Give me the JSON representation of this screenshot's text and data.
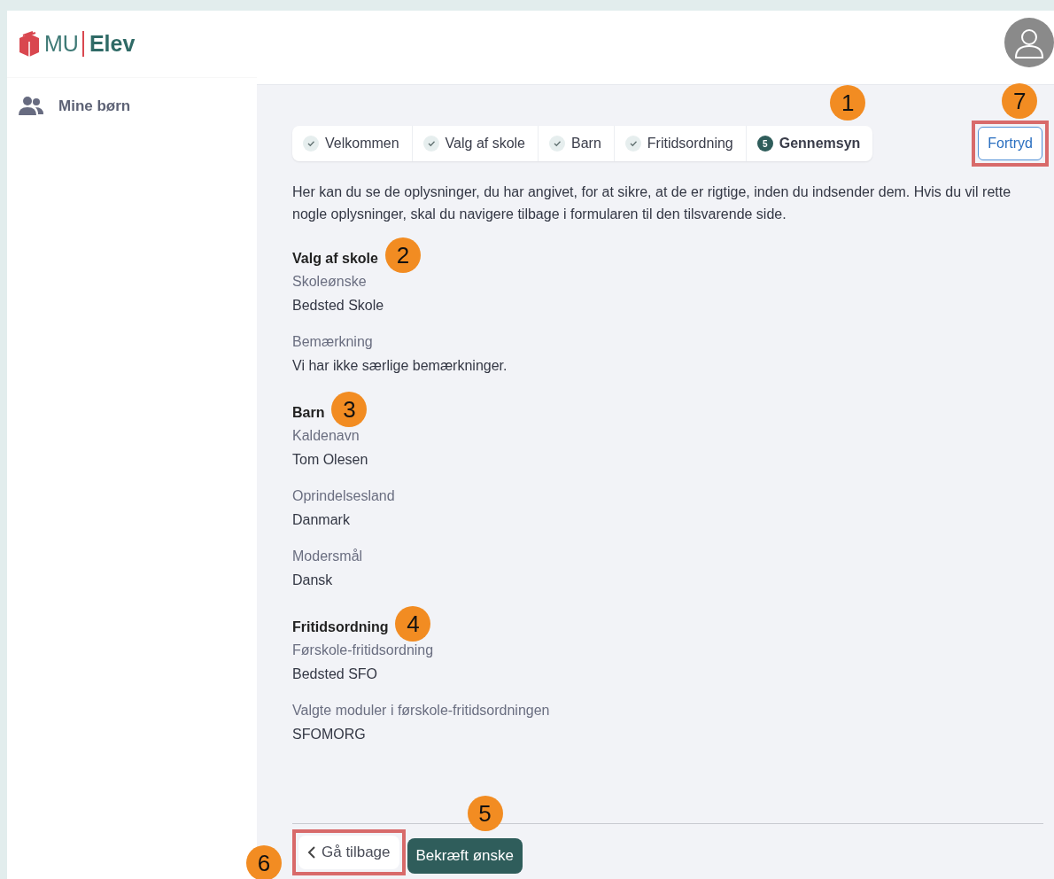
{
  "sidebar": {
    "logo": {
      "mark": "MU",
      "name": "Elev"
    },
    "items": [
      {
        "label": "Mine børn"
      }
    ]
  },
  "stepper": {
    "callout": "1",
    "steps": [
      {
        "kind": "done",
        "label": "Velkommen"
      },
      {
        "kind": "done",
        "label": "Valg af skole"
      },
      {
        "kind": "done",
        "label": "Barn"
      },
      {
        "kind": "done",
        "label": "Fritidsordning"
      },
      {
        "kind": "current",
        "number": "5",
        "label": "Gennemsyn"
      }
    ]
  },
  "cancel_button": {
    "label": "Fortryd",
    "callout": "7",
    "highlighted": true
  },
  "intro": "Her kan du se de oplysninger, du har angivet, for at sikre, at de er rigtige, inden du indsender dem. Hvis du vil rette nogle oplysninger, skal du navigere tilbage i formularen til den tilsvarende side.",
  "sections": [
    {
      "title": "Valg af skole",
      "callout": "2",
      "fields": [
        {
          "label": "Skoleønske",
          "value": "Bedsted Skole"
        },
        {
          "label": "Bemærkning",
          "value": "Vi har ikke særlige bemærkninger."
        }
      ]
    },
    {
      "title": "Barn",
      "callout": "3",
      "fields": [
        {
          "label": "Kaldenavn",
          "value": "Tom Olesen"
        },
        {
          "label": "Oprindelsesland",
          "value": "Danmark"
        },
        {
          "label": "Modersmål",
          "value": "Dansk"
        }
      ]
    },
    {
      "title": "Fritidsordning",
      "callout": "4",
      "fields": [
        {
          "label": "Førskole-fritidsordning",
          "value": "Bedsted SFO"
        },
        {
          "label": "Valgte moduler i førskole-fritidsordningen",
          "value": "SFOMORG"
        }
      ]
    }
  ],
  "back_button": {
    "label": "Gå tilbage",
    "callout": "6",
    "highlighted": true
  },
  "confirm_button": {
    "label": "Bekræft ønske",
    "callout": "5",
    "highlighted": false
  }
}
